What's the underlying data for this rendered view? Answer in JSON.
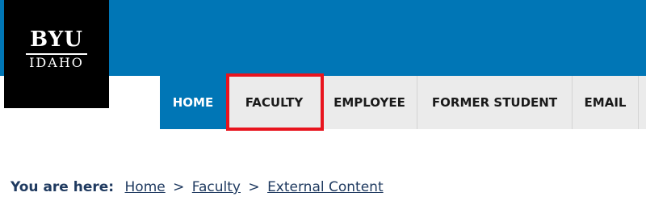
{
  "logo": {
    "top": "BYU",
    "bottom": "IDAHO"
  },
  "nav": {
    "tabs": [
      {
        "label": "HOME",
        "active": true
      },
      {
        "label": "FACULTY",
        "active": false,
        "highlighted": true
      },
      {
        "label": "EMPLOYEE",
        "active": false
      },
      {
        "label": "FORMER STUDENT",
        "active": false
      },
      {
        "label": "EMAIL",
        "active": false
      }
    ]
  },
  "breadcrumb": {
    "prefix": "You are here:",
    "separator": ">",
    "items": [
      "Home",
      "Faculty",
      "External Content"
    ]
  },
  "colors": {
    "brand_blue": "#0076b6",
    "tab_gray": "#ebebeb",
    "highlight_red": "#e8141e",
    "breadcrumb_text": "#1f3a60"
  }
}
